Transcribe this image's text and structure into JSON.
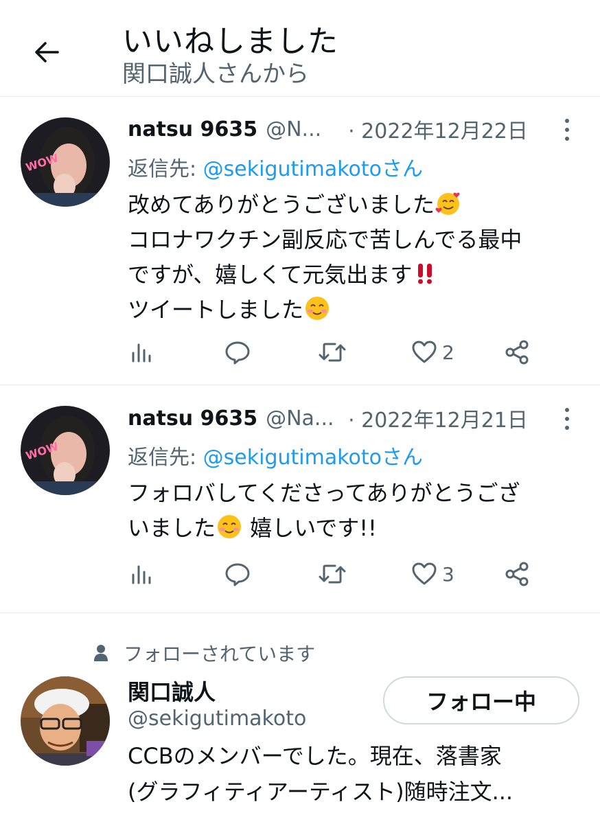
{
  "header": {
    "title": "いいねしました",
    "subtitle": "関口誠人さんから"
  },
  "tweets": [
    {
      "name": "natsu 9635",
      "handle": "@N...",
      "date": "· 2022年12月22日",
      "reply_prefix": "返信先: ",
      "reply_to": "@sekigutimakotoさん",
      "lines": [
        "改めてありがとうございました",
        "コロナワクチン副反応で苦しんでる最中",
        "ですが、嬉しくて元気出ます",
        "ツイートしました"
      ],
      "emoji_icons": [
        "smiling-face-with-hearts-icon",
        "double-exclamation-icon",
        "smiling-face-icon"
      ],
      "like_count": "2"
    },
    {
      "name": "natsu 9635",
      "handle": "@Na...",
      "date": "· 2022年12月21日",
      "reply_prefix": "返信先: ",
      "reply_to": "@sekigutimakotoさん",
      "lines": [
        "フォロバしてくださってありがとうござ",
        "いました",
        " 嬉しいです!!"
      ],
      "emoji_icons": [
        "smiling-face-icon"
      ],
      "like_count": "3"
    }
  ],
  "user": {
    "followed_label": "フォローされています",
    "name": "関口誠人",
    "handle": "@sekigutimakoto",
    "follow_button": "フォロー中",
    "bio_lines": [
      "CCBのメンバーでした。現在、落書家",
      "(グラフィティアーティスト)随時注文..."
    ]
  },
  "colors": {
    "text": "#0f1419",
    "secondary": "#536471",
    "link": "#1d9bf0",
    "divider": "#e6e9eb"
  }
}
